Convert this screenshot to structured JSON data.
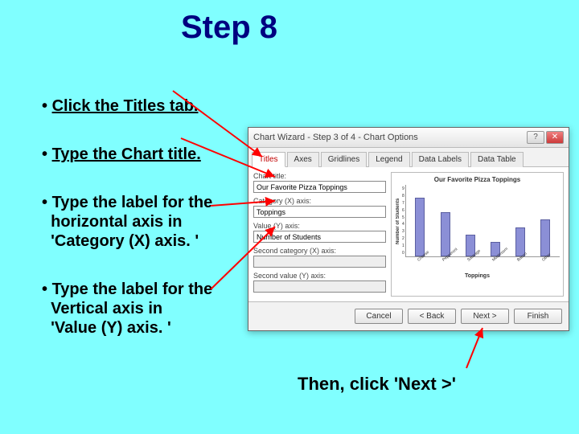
{
  "step_title": "Step 8",
  "bullet_titles": "Click the Titles tab.",
  "bullet_chart_title": "Type the Chart title.",
  "bullet_x_1": "Type the label for the",
  "bullet_x_2": "horizontal axis in",
  "bullet_x_3": "'Category (X) axis. '",
  "bullet_y_1": "Type the label for the",
  "bullet_y_2": "Vertical axis in",
  "bullet_y_3": "'Value (Y) axis. '",
  "then_click": "Then, click 'Next >'",
  "dialog": {
    "caption": "Chart Wizard - Step 3 of 4 - Chart Options",
    "tabs": {
      "titles": "Titles",
      "axes": "Axes",
      "gridlines": "Gridlines",
      "legend": "Legend",
      "datalabels": "Data Labels",
      "datatable": "Data Table"
    },
    "labels": {
      "chart_title": "Chart title:",
      "cat_x": "Category (X) axis:",
      "val_y": "Value (Y) axis:",
      "sec_x": "Second category (X) axis:",
      "sec_y": "Second value (Y) axis:"
    },
    "inputs": {
      "chart_title": "Our Favorite Pizza Toppings",
      "cat_x": "Toppings",
      "val_y": "Number of Students"
    },
    "buttons": {
      "cancel": "Cancel",
      "back": "< Back",
      "next": "Next >",
      "finish": "Finish"
    }
  },
  "chart_data": {
    "type": "bar",
    "title": "Our Favorite Pizza Toppings",
    "xlabel": "Toppings",
    "ylabel": "Number of Students",
    "ylim": [
      0,
      9
    ],
    "categories": [
      "Cheese",
      "Pepperoni",
      "Sausage",
      "Mushroom",
      "Bacon",
      "Other"
    ],
    "values": [
      8,
      6,
      3,
      2,
      4,
      5
    ]
  }
}
